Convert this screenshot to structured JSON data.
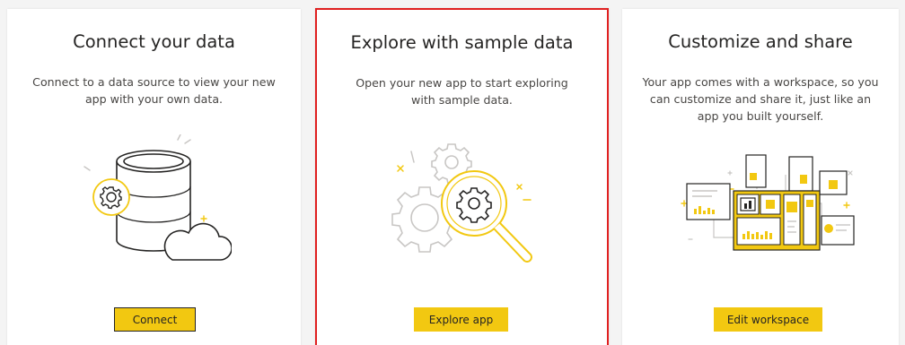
{
  "cards": [
    {
      "title": "Connect your data",
      "description": "Connect to a data source to view your new app with your own data.",
      "button_label": "Connect",
      "illustration_icon": "database-cloud-gear-icon"
    },
    {
      "title": "Explore with sample data",
      "description": "Open your new app to start exploring with sample data.",
      "button_label": "Explore app",
      "illustration_icon": "magnifier-gears-icon"
    },
    {
      "title": "Customize and share",
      "description": "Your app comes with a workspace, so you can customize and share it, just like an app you built yourself.",
      "button_label": "Edit workspace",
      "illustration_icon": "workspace-dashboards-icon"
    }
  ],
  "colors": {
    "accent": "#f2c811",
    "highlight_border": "#e02020",
    "line": "#252423",
    "muted_line": "#c8c6c4"
  }
}
